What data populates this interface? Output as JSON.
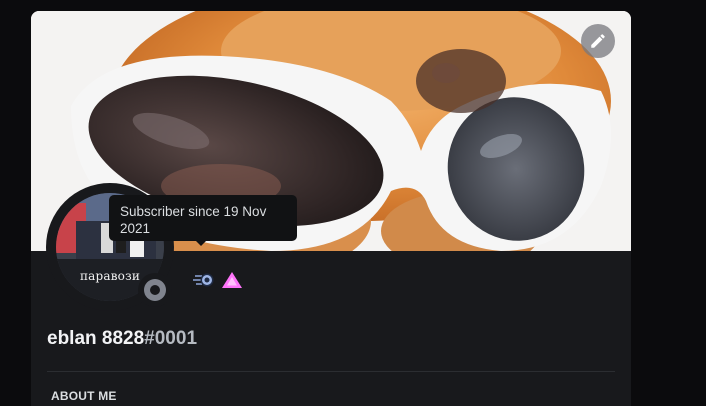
{
  "profile": {
    "username": "eblan 8828",
    "discriminator": "#0001",
    "avatar_caption": "паравози",
    "status": "offline"
  },
  "edit_button": {
    "icon": "pencil-icon"
  },
  "badges": [
    {
      "icon": "hypesquad-balance-icon"
    },
    {
      "icon": "nitro-triangle-icon",
      "color": "#ff73fa"
    }
  ],
  "tooltip": {
    "text": "Subscriber since 19 Nov 2021"
  },
  "sections": {
    "about_me": "ABOUT ME"
  },
  "colors": {
    "card_bg": "#18191c",
    "page_bg": "#0b0b0d",
    "status_offline": "#80848e"
  }
}
